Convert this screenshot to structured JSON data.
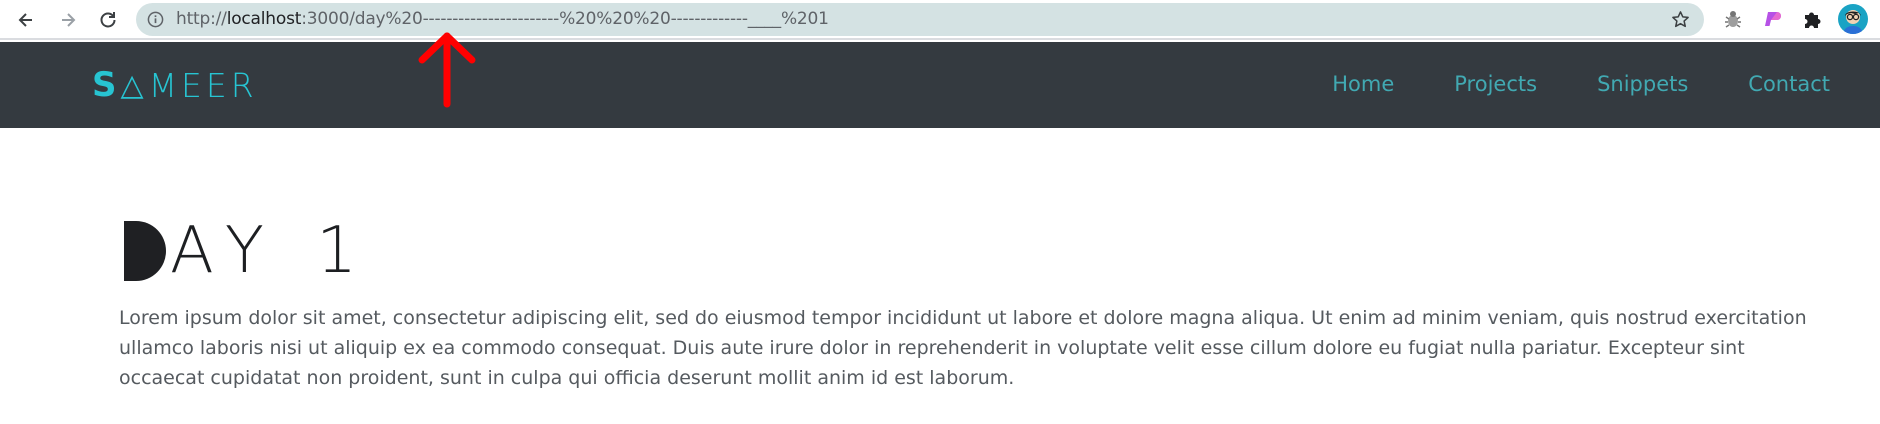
{
  "browser": {
    "url_prefix": "http://",
    "url_host": "localhost",
    "url_rest": ":3000/day%20-----------------------%20%20%20-------------____%201",
    "icons": [
      "back-arrow-icon",
      "forward-arrow-icon",
      "reload-icon",
      "info-icon",
      "star-icon",
      "bug-extension-icon",
      "purple-extension-icon",
      "puzzle-icon",
      "profile-avatar"
    ]
  },
  "site": {
    "logo_s": "S",
    "logo_tri": "△",
    "logo_rest": "MEER",
    "nav": [
      "Home",
      "Projects",
      "Snippets",
      "Contact"
    ]
  },
  "content": {
    "heading": "AY 1",
    "paragraph": "Lorem ipsum dolor sit amet, consectetur adipiscing elit, sed do eiusmod tempor incididunt ut labore et dolore magna aliqua. Ut enim ad minim veniam, quis nostrud exercitation ullamco laboris nisi ut aliquip ex ea commodo consequat. Duis aute irure dolor in reprehenderit in voluptate velit esse cillum dolore eu fugiat nulla pariatur. Excepteur sint occaecat cupidatat non proident, sunt in culpa qui officia deserunt mollit anim id est laborum."
  },
  "colors": {
    "header_bg": "#343a40",
    "accent": "#27c4d2",
    "nav_link": "#41a9b2",
    "annotation": "#ff0000"
  }
}
